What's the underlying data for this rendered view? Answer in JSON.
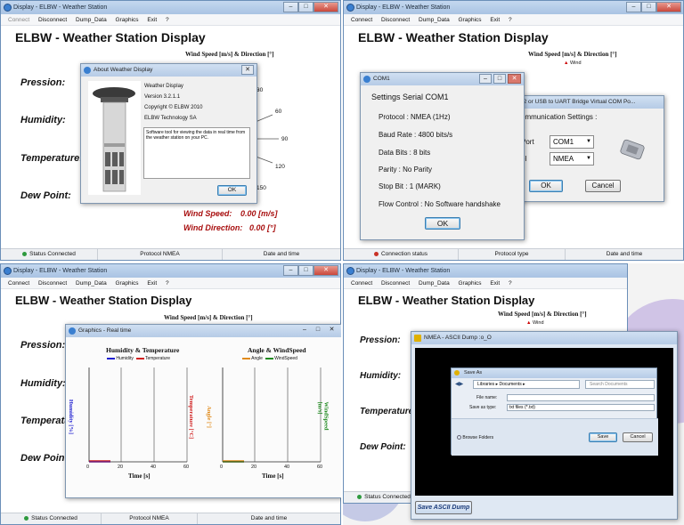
{
  "common": {
    "window_title": "Display - ELBW - Weather Station",
    "app_title": "ELBW - Weather Station Display",
    "wind_header": "Wind Speed [m/s] & Direction [°]",
    "menu": [
      "Connect",
      "Disconnect",
      "Dump_Data",
      "Graphics",
      "Exit",
      "?"
    ],
    "labels": {
      "pression": "Pression:",
      "humidity": "Humidity:",
      "temperature": "Temperature:",
      "dew_point": "Dew Point:"
    },
    "wind_legend": "Wind"
  },
  "q1": {
    "about": {
      "title": "About Weather Display",
      "name": "Weather Display",
      "version": "Version 3.2.1.1",
      "copyright": "Copyright © ELBW 2010",
      "company": "ELBW Technology SA",
      "description": "Software tool for viewing the data in real time from the weather station on your PC.",
      "ok": "OK"
    },
    "ticks": [
      "30",
      "60",
      "90",
      "120",
      "150"
    ],
    "wind_speed_label": "Wind Speed:",
    "wind_speed_value": "0.00 [m/s]",
    "wind_direction_label": "Wind Direction:",
    "wind_direction_value": "0.00 [°]",
    "status": [
      "Status Connected",
      "Protocol NMEA",
      "Date and time"
    ]
  },
  "q2": {
    "com_dialog": {
      "title": "COM1",
      "heading": "Settings Serial COM1",
      "rows": [
        {
          "label": "Protocol :",
          "value": "NMEA (1Hz)"
        },
        {
          "label": "Baud Rate :",
          "value": "4800 bits/s"
        },
        {
          "label": "Data Bits :",
          "value": "8 bits"
        },
        {
          "label": "Parity :",
          "value": "No Parity"
        },
        {
          "label": "Stop Bit :",
          "value": "1 (MARK)"
        },
        {
          "label": "Flow Control :",
          "value": "No Software handshake"
        }
      ],
      "ok": "OK"
    },
    "bridge_dialog": {
      "title": "32 or USB to UART Bridge Virtual COM Po...",
      "section": "ommunication Settings :",
      "port_label": "Port",
      "port_value": "COM1",
      "protocol_label": "ol",
      "protocol_value": "NMEA",
      "ok": "OK",
      "cancel": "Cancel"
    },
    "status": [
      "Connection status",
      "Protocol type",
      "Date and time"
    ]
  },
  "q3": {
    "graphics": {
      "title": "Graphics - Real time",
      "chart1": {
        "title": "Humidity & Temperature",
        "legend": [
          "Humidity",
          "Temperature"
        ],
        "ylabel_left": "Humidity [%]",
        "ylabel_right": "Temperature [°C]"
      },
      "chart2": {
        "title": "Angle & WindSpeed",
        "legend": [
          "Angle",
          "WindSpeed"
        ],
        "ylabel_left": "Angle [°]",
        "ylabel_right": "WindSpeed [m/s]"
      },
      "xticks": [
        "0",
        "20",
        "40",
        "60"
      ],
      "xlabel": "Time [s]"
    },
    "status": [
      "Status Connected",
      "Protocol NMEA",
      "Date and time"
    ]
  },
  "q4": {
    "dump": {
      "title": "NMEA - ASCII Dump :o_O",
      "save_button": "Save ASCII Dump"
    },
    "save_dialog": {
      "title": "Save As",
      "path": "Libraries  ▸  Documents  ▸",
      "search_placeholder": "Search Documents",
      "file_name_label": "File name:",
      "save_as_type_label": "Save as type:",
      "save_as_type_value": "txt files (*.txt)",
      "browse_folders": "Browse Folders",
      "save": "Save",
      "cancel": "Cancel"
    },
    "status": [
      "Status Connected"
    ]
  },
  "colors": {
    "humidity": "#1f1fd0",
    "temperature": "#d01f1f",
    "angle": "#e08a1a",
    "windspeed": "#1f8a1f",
    "wind_text": "#a80f0f"
  }
}
